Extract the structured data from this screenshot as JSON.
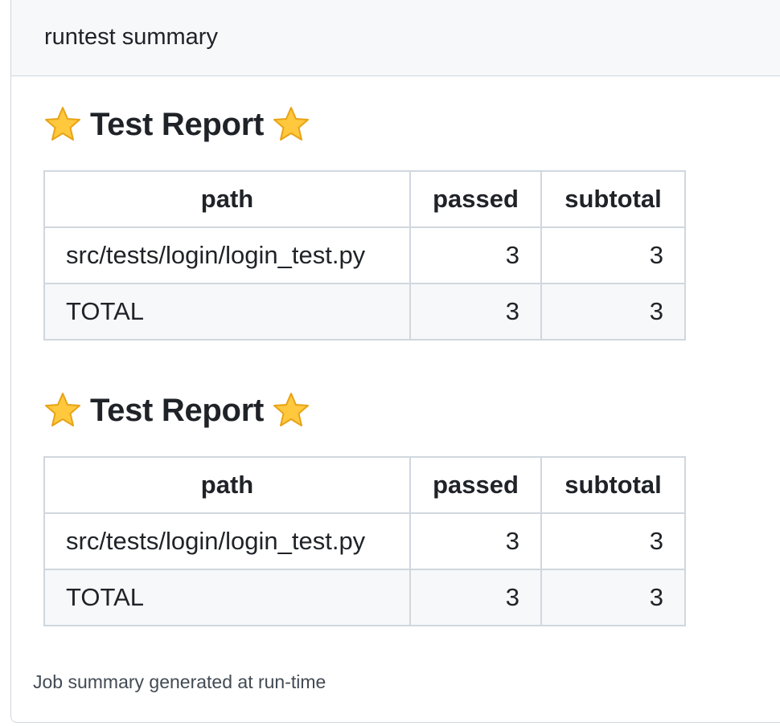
{
  "summary": {
    "title": "runtest summary",
    "footer": "Job summary generated at run-time"
  },
  "reports": [
    {
      "heading": "Test Report",
      "icons": [
        "star-icon",
        "star-icon"
      ],
      "columns": [
        "path",
        "passed",
        "subtotal"
      ],
      "rows": [
        {
          "path": "src/tests/login/login_test.py",
          "passed": "3",
          "subtotal": "3"
        },
        {
          "path": "TOTAL",
          "passed": "3",
          "subtotal": "3"
        }
      ]
    },
    {
      "heading": "Test Report",
      "icons": [
        "star-icon",
        "star-icon"
      ],
      "columns": [
        "path",
        "passed",
        "subtotal"
      ],
      "rows": [
        {
          "path": "src/tests/login/login_test.py",
          "passed": "3",
          "subtotal": "3"
        },
        {
          "path": "TOTAL",
          "passed": "3",
          "subtotal": "3"
        }
      ]
    }
  ],
  "colors": {
    "star": "#FFC83D",
    "star_outline": "#E8A317",
    "border": "#d0d7de",
    "header_bg": "#f6f8fa"
  }
}
